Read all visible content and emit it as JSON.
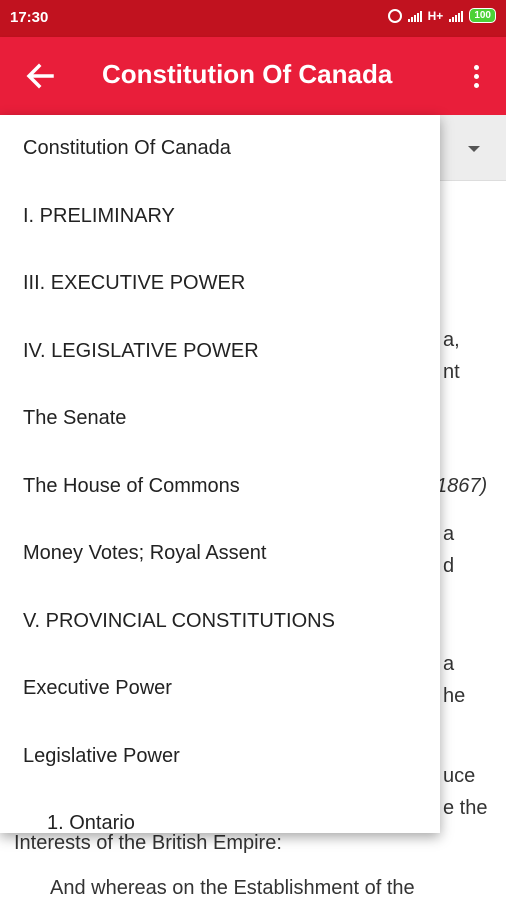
{
  "status": {
    "time": "17:30",
    "network": "H+",
    "battery": "100"
  },
  "app_bar": {
    "title": "Constitution Of Canada"
  },
  "content_fragments": [
    "a,",
    "nt",
    "1867)",
    "a",
    "d",
    "a",
    "he",
    "uce",
    "e the",
    "Interests of the British Empire:",
    "And whereas on the Establishment of the"
  ],
  "dropdown": {
    "items": [
      "Constitution Of Canada",
      "I. PRELIMINARY",
      "III. EXECUTIVE POWER",
      "IV. LEGISLATIVE POWER",
      "The Senate",
      "The House of Commons",
      "Money Votes; Royal Assent",
      "V. PROVINCIAL CONSTITUTIONS",
      "Executive Power",
      "Legislative Power",
      "1. Ontario"
    ]
  }
}
